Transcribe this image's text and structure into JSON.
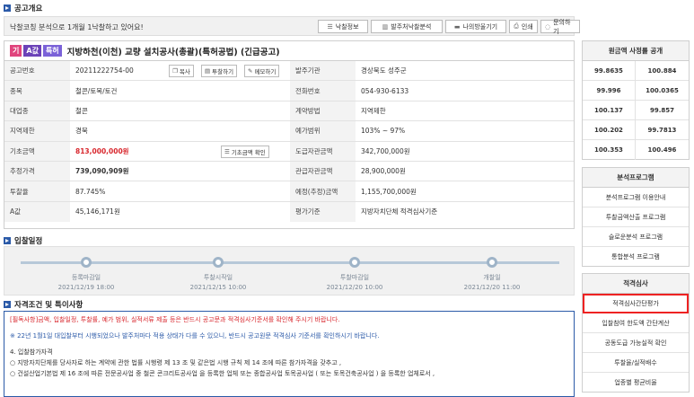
{
  "sections": {
    "overview": "공고개요",
    "schedule": "입찰일정",
    "conditions": "자격조건 및 특이사항"
  },
  "notice": {
    "text": "낙찰코칭 분석으로 1개월 1낙찰하고 있어요!",
    "buttons": [
      "낙찰정보",
      "발주처낙찰분석",
      "나의방울기기",
      "인쇄",
      "문의하기"
    ]
  },
  "title": {
    "badges": [
      "기",
      "A값",
      "특허"
    ],
    "text": "지방하천(이천) 교량 설치공사(총괄)(특허공법) (긴급공고)"
  },
  "table": {
    "rows": [
      {
        "l1": "공고번호",
        "v1": "20211222754-00",
        "l2": "발주기관",
        "v2": "경상북도 성주군"
      },
      {
        "l1": "종목",
        "v1": "철콘/토목/토건",
        "l2": "전화번호",
        "v2": "054-930-6133"
      },
      {
        "l1": "대업종",
        "v1": "철콘",
        "l2": "계약방법",
        "v2": "지역제한"
      },
      {
        "l1": "지역제한",
        "v1": "경북",
        "l2": "예가범위",
        "v2": "103% ~ 97%"
      },
      {
        "l1": "기초금액",
        "v1": "813,000,000원",
        "l2": "도급자관금액",
        "v2": "342,700,000원"
      },
      {
        "l1": "추정가격",
        "v1": "739,090,909원",
        "l2": "관급자관금액",
        "v2": "28,900,000원"
      },
      {
        "l1": "투찰율",
        "v1": "87.745%",
        "l2": "예정(추정)금액",
        "v2": "1,155,700,000원"
      },
      {
        "l1": "A값",
        "v1": "45,146,171원",
        "l2": "평가기준",
        "v2": "지방자치단체 적격심사기준"
      }
    ],
    "actions": {
      "copy": "복사",
      "bid": "투찰하기",
      "memo": "메모하기",
      "base_check": "기초금액 확인"
    }
  },
  "schedule": [
    {
      "label": "등록마감일",
      "date": "2021/12/19 18:00"
    },
    {
      "label": "투찰시작일",
      "date": "2021/12/15 10:00"
    },
    {
      "label": "투찰마감일",
      "date": "2021/12/20 10:00"
    },
    {
      "label": "개찰일",
      "date": "2021/12/20 11:00"
    }
  ],
  "conditions": {
    "line1": "[필독사항]금액, 입찰일정, 투찰률, 예가 범위, 실적서류 제출 등은 반드시 공고문과 적격심사기준서를 확인해 주시기 바랍니다.",
    "line2": "※ 22년 1월1일 대입찰부터 시행되었으나 발주처마다 적용 상태가 다를 수 있으니, 반드시 공고원문 적격심사 기준서를 확인하시기 바랍니다.",
    "line3": "4. 입찰참가자격",
    "line4": "○ 지방자치단체를 당사자로 하는 계약에 관한 법률 시행령 제 13 조 및 같은법 시행 규칙 제 14 조에 따른 참가자격을 갖추고 ,",
    "line5": "○ 건설산업기본법 제 16 조에 따른 전문공사업 중 철콘 콘크리트공사업 을 등록한 업체 또는 종합공사업 토목공사업 ( 또는 토목건축공사업 ) 을 등록한 업체로서 ,"
  },
  "sidebar": {
    "compare_title": "원금액 사정률 공개",
    "compare": [
      [
        "99.8635",
        "100.884"
      ],
      [
        "99.996",
        "100.0365"
      ],
      [
        "100.137",
        "99.857"
      ],
      [
        "100.202",
        "99.7813"
      ],
      [
        "100.353",
        "100.496"
      ]
    ],
    "analysis_title": "분석프로그램",
    "analysis": [
      "분석프로그램 이용안내",
      "투찰금액산출 프로그램",
      "슬로운분석 프로그램",
      "통합분석 프로그램"
    ],
    "exam_title": "적격심사",
    "exam": [
      "적격심사간단평가",
      "입찰참여 한도액 간단계산",
      "공동도급 가능실적 확인",
      "투찰율/실적배수",
      "업종별 평균비율"
    ]
  }
}
